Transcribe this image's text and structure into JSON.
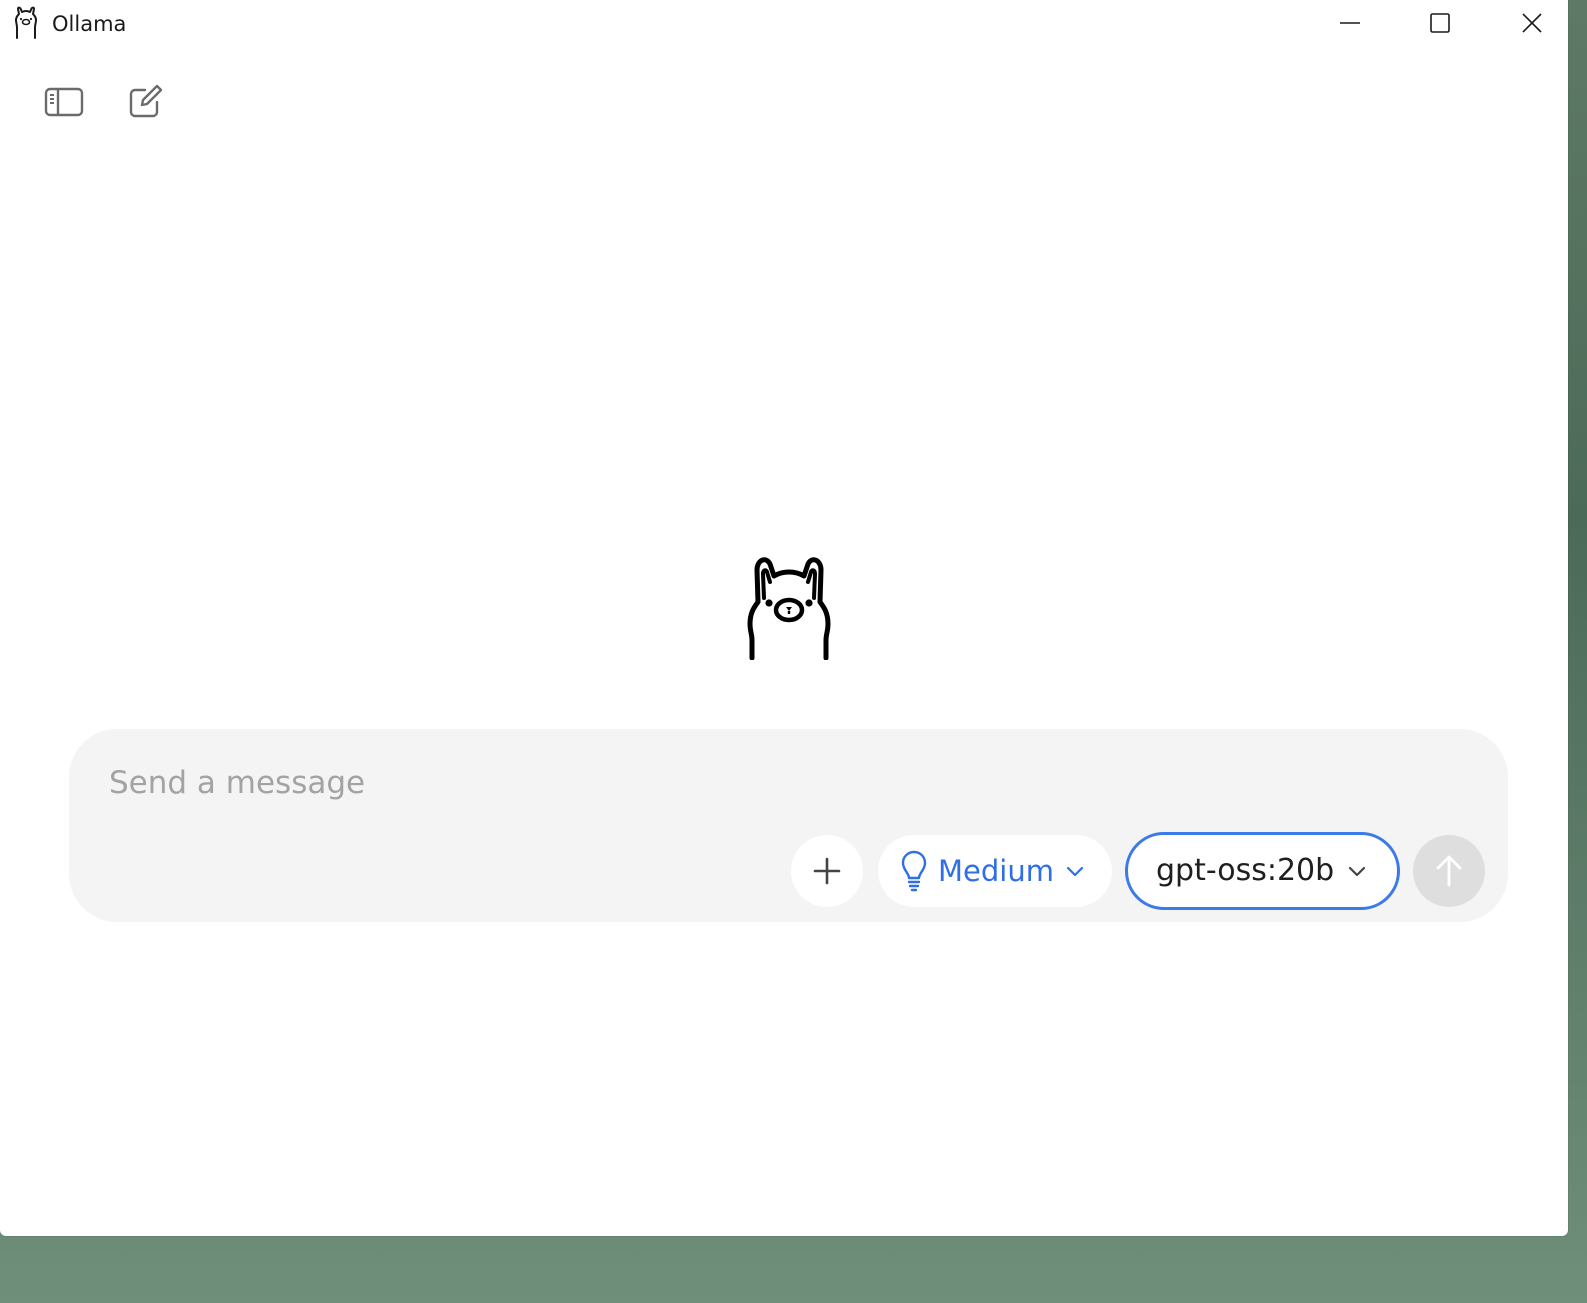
{
  "window": {
    "title": "Ollama"
  },
  "titlebar": {
    "minimize_icon": "minimize-icon",
    "maximize_icon": "maximize-icon",
    "close_icon": "close-icon"
  },
  "toolbar": {
    "sidebar_icon": "sidebar-toggle-icon",
    "new_chat_icon": "new-chat-icon"
  },
  "composer": {
    "placeholder": "Send a message",
    "value": "",
    "add_icon": "plus-icon",
    "think": {
      "icon": "lightbulb-icon",
      "label": "Medium"
    },
    "model": {
      "label": "gpt-oss:20b"
    },
    "send_icon": "arrow-up-icon"
  },
  "colors": {
    "accent": "#3b7ae8",
    "think_text": "#2f6fe6",
    "composer_bg": "#f4f4f4",
    "send_disabled_bg": "#dedede"
  }
}
